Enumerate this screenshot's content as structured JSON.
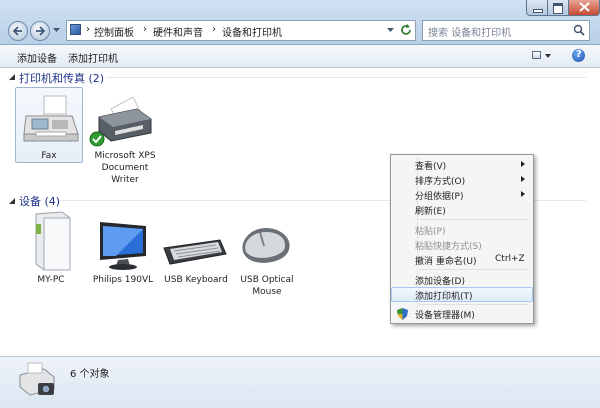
{
  "window": {
    "breadcrumb": [
      "控制面板",
      "硬件和声音",
      "设备和打印机"
    ],
    "search_placeholder": "搜索 设备和打印机",
    "buttons": {
      "minimize": "minimize-icon",
      "maximize": "maximize-icon",
      "close": "close-icon"
    }
  },
  "toolbar": {
    "add_device": "添加设备",
    "add_printer": "添加打印机"
  },
  "groups": {
    "printers": {
      "title": "打印机和传真 (2)",
      "items": [
        {
          "label": "Fax"
        },
        {
          "label": "Microsoft XPS\nDocument\nWriter"
        }
      ]
    },
    "devices": {
      "title": "设备 (4)",
      "items": [
        {
          "label": "MY-PC"
        },
        {
          "label": "Philips 190VL"
        },
        {
          "label": "USB Keyboard"
        },
        {
          "label": "USB Optical\nMouse"
        }
      ]
    }
  },
  "status": {
    "count": "6 个对象"
  },
  "context_menu": [
    {
      "label": "查看(V)",
      "submenu": true
    },
    {
      "label": "排序方式(O)",
      "submenu": true
    },
    {
      "label": "分组依据(P)",
      "submenu": true
    },
    {
      "label": "刷新(E)"
    },
    {
      "label": "粘贴(P)",
      "disabled": true
    },
    {
      "label": "粘贴快捷方式(S)",
      "disabled": true
    },
    {
      "label": "撤消 重命名(U)",
      "shortcut": "Ctrl+Z"
    },
    {
      "label": "添加设备(D)"
    },
    {
      "label": "添加打印机(T)",
      "highlighted": true
    },
    {
      "label": "设备管理器(M)",
      "icon": "shield-icon"
    }
  ],
  "colors": {
    "group_title": "#1e3287",
    "menu_highlight": "#ddebfa",
    "check": "#2f9a2f"
  }
}
